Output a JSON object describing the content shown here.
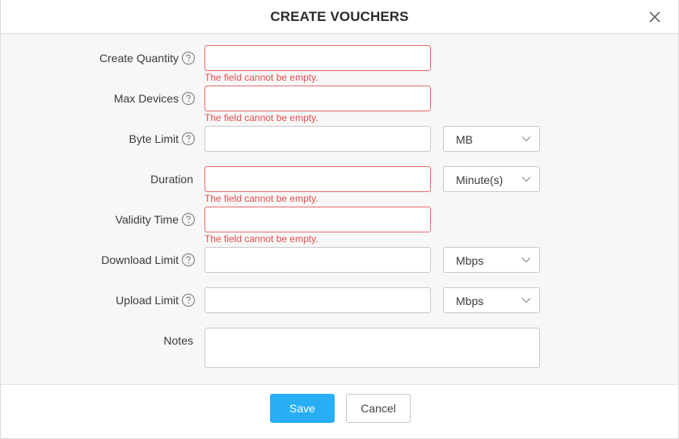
{
  "dialog": {
    "title": "CREATE VOUCHERS",
    "close_icon": "close-icon"
  },
  "form": {
    "help_icon": "question-circle-icon",
    "error_text": "The field cannot be empty.",
    "fields": {
      "create_quantity": {
        "label": "Create Quantity",
        "value": "",
        "has_help": true,
        "error": true
      },
      "max_devices": {
        "label": "Max Devices",
        "value": "",
        "has_help": true,
        "error": true
      },
      "byte_limit": {
        "label": "Byte Limit",
        "value": "",
        "has_help": true,
        "error": false,
        "unit": "MB"
      },
      "duration": {
        "label": "Duration",
        "value": "",
        "has_help": false,
        "error": true,
        "unit": "Minute(s)"
      },
      "validity_time": {
        "label": "Validity Time",
        "value": "",
        "has_help": true,
        "error": true
      },
      "download_limit": {
        "label": "Download Limit",
        "value": "",
        "has_help": true,
        "error": false,
        "unit": "Mbps"
      },
      "upload_limit": {
        "label": "Upload Limit",
        "value": "",
        "has_help": true,
        "error": false,
        "unit": "Mbps"
      },
      "notes": {
        "label": "Notes",
        "value": "",
        "has_help": false
      }
    }
  },
  "footer": {
    "save_label": "Save",
    "cancel_label": "Cancel"
  },
  "colors": {
    "primary": "#27aef5",
    "error": "#e05050",
    "error_border": "#e56b6b",
    "body_bg": "#f7f7f7"
  }
}
